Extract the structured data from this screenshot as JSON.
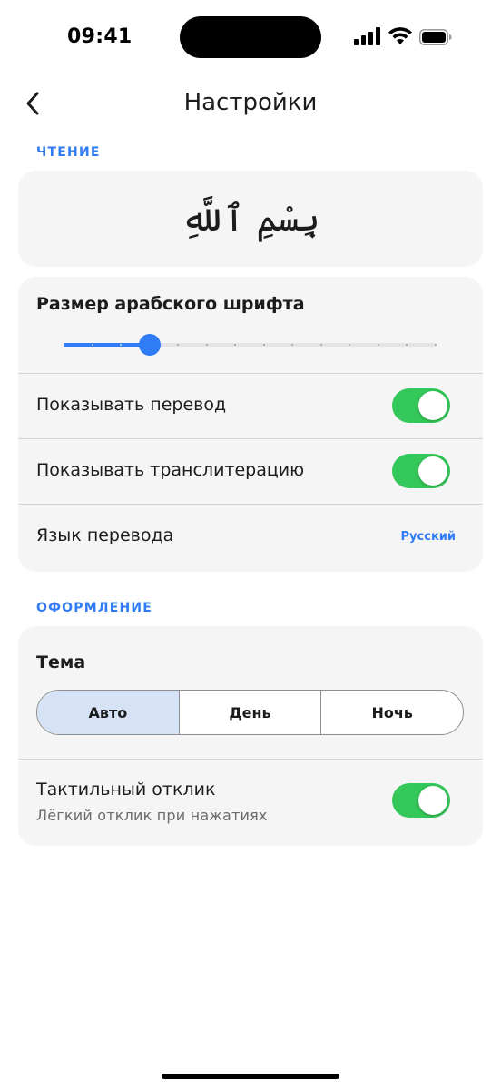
{
  "status_bar": {
    "time": "09:41",
    "icons": [
      "cellular-signal-icon",
      "wifi-icon",
      "battery-icon"
    ]
  },
  "nav": {
    "title": "Настройки",
    "back_icon": "chevron-left-icon"
  },
  "reading": {
    "section_label": "ЧТЕНИЕ",
    "preview_text": "بِسْمِ ٱللَّهِ",
    "font_size": {
      "label": "Размер арабского шрифта",
      "steps": 14,
      "selected_step": 3
    },
    "show_translation": {
      "label": "Показывать перевод",
      "on": true
    },
    "show_transliteration": {
      "label": "Показывать транслитерацию",
      "on": true
    },
    "translation_language": {
      "label": "Язык перевода",
      "value": "Русский"
    }
  },
  "appearance": {
    "section_label": "ОФОРМЛЕНИЕ",
    "theme": {
      "label": "Тема",
      "options": [
        "Авто",
        "День",
        "Ночь"
      ],
      "selected": "Авто"
    },
    "haptics": {
      "label": "Тактильный отклик",
      "sublabel": "Лёгкий отклик при нажатиях",
      "on": true
    }
  },
  "colors": {
    "accent": "#2f7cf6",
    "toggle_on": "#34c759",
    "card_bg": "#f5f5f5",
    "segment_selected": "#d6e2f5"
  }
}
